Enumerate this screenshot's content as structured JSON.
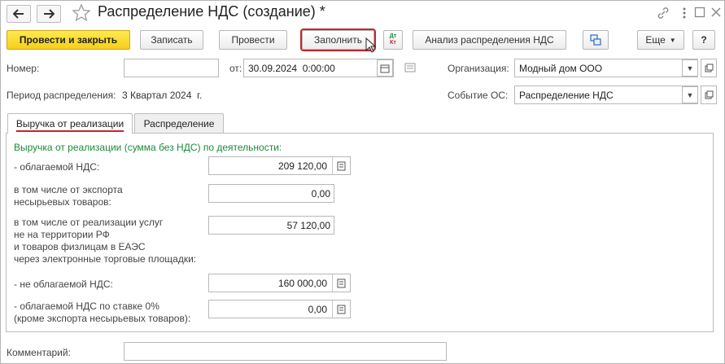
{
  "window": {
    "title": "Распределение НДС (создание) *",
    "back_icon": "arrow-left-icon",
    "forward_icon": "arrow-right-icon",
    "favorite_icon": "star-icon",
    "link_icon": "link-icon",
    "more_icon": "vertical-dots-icon",
    "maximize_icon": "maximize-icon",
    "close_icon": "close-icon"
  },
  "toolbar": {
    "post_close": "Провести и закрыть",
    "save": "Записать",
    "post": "Провести",
    "fill": "Заполнить",
    "dt_kt_top": "Дт",
    "dt_kt_bottom": "Кт",
    "analysis": "Анализ распределения НДС",
    "more": "Еще",
    "help": "?"
  },
  "header": {
    "number_label": "Номер:",
    "number_value": "",
    "from_label": "от:",
    "date_value": "30.09.2024  0:00:00",
    "org_label": "Организация:",
    "org_value": "Модный дом ООО",
    "period_label": "Период распределения:",
    "period_value": "3 Квартал 2024  г.",
    "event_label": "Событие ОС:",
    "event_value": "Распределение НДС"
  },
  "tabs": [
    {
      "label": "Выручка от реализации",
      "active": true
    },
    {
      "label": "Распределение",
      "active": false
    }
  ],
  "revenue": {
    "section_title": "Выручка от реализации (сумма без НДС) по деятельности:",
    "taxable_label": "- облагаемой НДС:",
    "taxable_value": "209 120,00",
    "export_label_1": "в том числе от экспорта",
    "export_label_2": "несырьевых товаров:",
    "export_value": "0,00",
    "services_label_1": "в том числе от реализации услуг",
    "services_label_2": "не на территории РФ",
    "services_label_3": "и товаров физлицам в ЕАЭС",
    "services_label_4": "через электронные торговые площадки:",
    "services_value": "57 120,00",
    "nontaxable_label": "- не облагаемой НДС:",
    "nontaxable_value": "160 000,00",
    "zero_rate_label_1": "- облагаемой НДС по ставке 0%",
    "zero_rate_label_2": "(кроме экспорта несырьевых товаров):",
    "zero_rate_value": "0,00"
  },
  "footer": {
    "comment_label": "Комментарий:",
    "comment_value": ""
  },
  "colors": {
    "primary_button": "#f6cf1a",
    "highlight_outline": "#c8242b",
    "section_title": "#1a8a3a"
  }
}
